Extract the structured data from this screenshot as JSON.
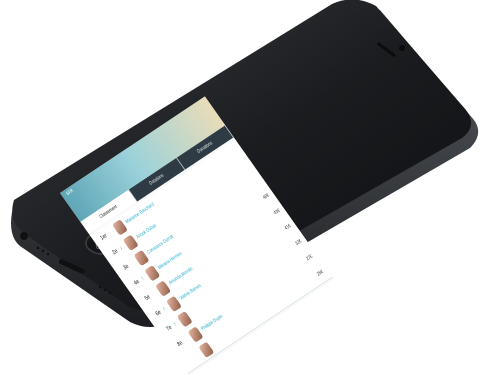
{
  "screen": {
    "carrier": "SFR",
    "tabs": [
      {
        "label": "Classement",
        "active": true
      },
      {
        "label": "Dotations",
        "active": false
      },
      {
        "label": "Donations",
        "active": false
      }
    ],
    "rows": [
      {
        "rank": "1er",
        "trend": "",
        "name": "Marianne Bouchard",
        "amount": ""
      },
      {
        "rank": "2e",
        "trend": "down",
        "name": "Anouk Dubas",
        "amount": ""
      },
      {
        "rank": "3e",
        "trend": "",
        "name": "Constance Dutroit",
        "amount": ""
      },
      {
        "rank": "4e",
        "trend": "up",
        "name": "Mikaela Hermes",
        "amount": "46€"
      },
      {
        "rank": "5e",
        "trend": "",
        "name": "Amanda Morelin",
        "amount": "43€"
      },
      {
        "rank": "6e",
        "trend": "up",
        "name": "Valérie Barnes",
        "amount": "41€"
      },
      {
        "rank": "7e",
        "trend": "up",
        "name": "",
        "amount": "32€"
      },
      {
        "rank": "8e",
        "trend": "",
        "name": "Philippe Dupin",
        "amount": "27€"
      },
      {
        "rank": "",
        "trend": "",
        "name": "",
        "amount": "25€"
      }
    ]
  },
  "colors": {
    "phone_body": "#1d1f22",
    "accent_name": "#2bb0cf",
    "trend_up": "#38b24a",
    "trend_down": "#e0413a"
  }
}
